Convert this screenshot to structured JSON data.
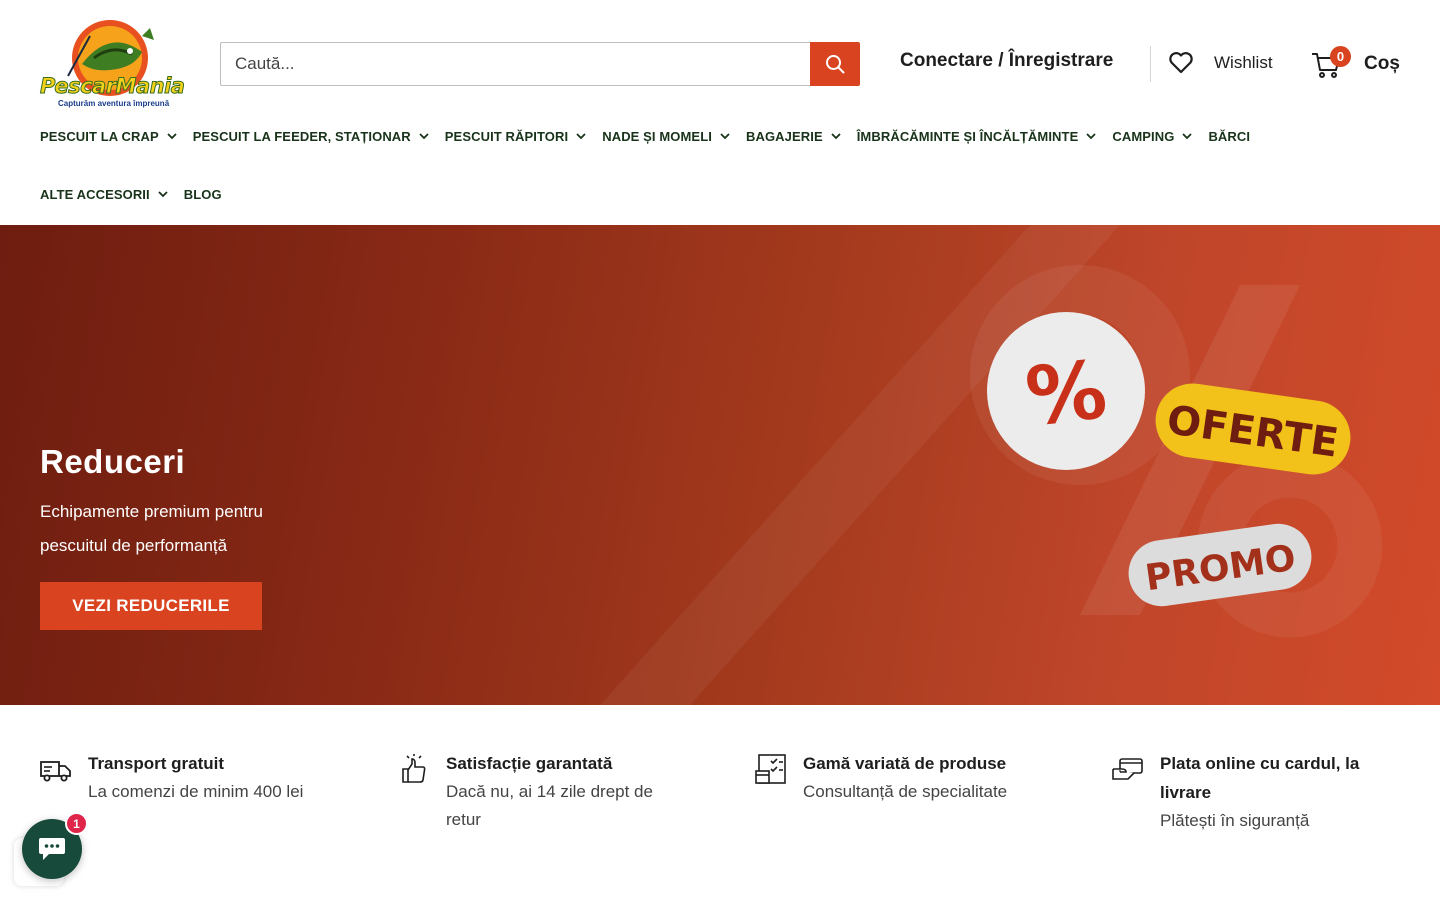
{
  "brand": {
    "name": "PescarMania",
    "tagline": "Capturăm aventura împreună"
  },
  "search": {
    "placeholder": "Caută..."
  },
  "header": {
    "account_label": "Conectare / Înregistrare",
    "wishlist_label": "Wishlist",
    "cart_label": "Coș",
    "cart_count": "0"
  },
  "nav": {
    "row1": [
      {
        "label": "PESCUIT LA CRAP",
        "dropdown": true
      },
      {
        "label": "PESCUIT LA FEEDER, STAȚIONAR",
        "dropdown": true
      },
      {
        "label": "PESCUIT RĂPITORI",
        "dropdown": true
      },
      {
        "label": "NADE ȘI MOMELI",
        "dropdown": true
      },
      {
        "label": "BAGAJERIE",
        "dropdown": true
      },
      {
        "label": "ÎMBRĂCĂMINTE ȘI ÎNCĂLȚĂMINTE",
        "dropdown": true
      },
      {
        "label": "CAMPING",
        "dropdown": true
      },
      {
        "label": "BĂRCI",
        "dropdown": false
      }
    ],
    "row2": [
      {
        "label": "ALTE ACCESORII",
        "dropdown": true
      },
      {
        "label": "BLOG",
        "dropdown": false
      }
    ]
  },
  "hero": {
    "title": "Reduceri",
    "subtitle": "Echipamente premium pentru pescuitul de performanță",
    "button_label": "VEZI REDUCERILE",
    "art": {
      "percent_symbol": "%",
      "tag_oferte": "OFERTE",
      "tag_promo": "PROMO"
    }
  },
  "features": [
    {
      "icon": "delivery-truck-icon",
      "title": "Transport gratuit",
      "desc": "La comenzi de minim 400 lei"
    },
    {
      "icon": "thumbs-up-icon",
      "title": "Satisfacție garantată",
      "desc": "Dacă nu, ai 14 zile drept de retur"
    },
    {
      "icon": "product-range-icon",
      "title": "Gamă variată de produse",
      "desc": "Consultanță de specialitate"
    },
    {
      "icon": "card-payment-icon",
      "title": "Plata online cu cardul, la livrare",
      "desc": "Plătești în siguranță"
    }
  ],
  "chat": {
    "unread_count": "1"
  },
  "colors": {
    "accent": "#d9431f",
    "nav_text": "#18331a",
    "hero_dark": "#6e1d10",
    "hero_light": "#d24a29",
    "chat_green": "#174a3b",
    "badge_red": "#e0254a",
    "oferte_yellow": "#f2c21a"
  }
}
